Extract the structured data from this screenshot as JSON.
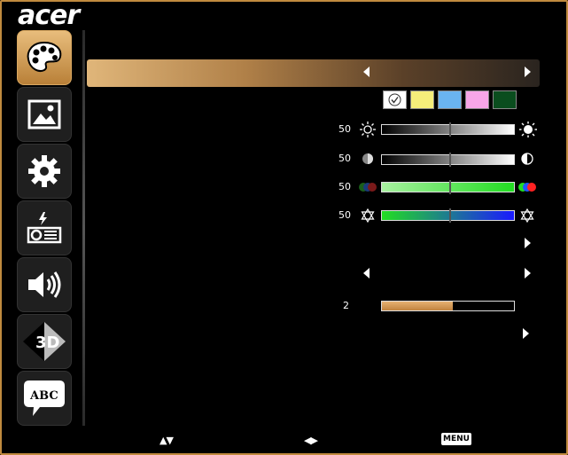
{
  "brand": {
    "logo_text": "acer"
  },
  "sidebar": {
    "items": [
      {
        "name": "color",
        "icon": "palette-icon",
        "active": true
      },
      {
        "name": "picture",
        "icon": "image-icon",
        "active": false
      },
      {
        "name": "settings",
        "icon": "gear-icon",
        "active": false
      },
      {
        "name": "input",
        "icon": "projector-icon",
        "active": false
      },
      {
        "name": "audio",
        "icon": "speaker-icon",
        "active": false
      },
      {
        "name": "3d",
        "icon": "3d-icon",
        "label": "3D",
        "active": false
      },
      {
        "name": "language",
        "icon": "speech-bubble-icon",
        "label": "ABC",
        "active": false
      }
    ]
  },
  "color_swatches": [
    {
      "name": "white",
      "color": "#ffffff",
      "selected": true
    },
    {
      "name": "yellow",
      "color": "#f5ee7a"
    },
    {
      "name": "blue",
      "color": "#6ab4f0"
    },
    {
      "name": "pink",
      "color": "#f7a6e8"
    },
    {
      "name": "dark-green",
      "color": "#0a4d1e"
    }
  ],
  "sliders": [
    {
      "name": "brightness",
      "value": "50",
      "left_icon": "sun-outline-icon",
      "right_icon": "sun-filled-icon"
    },
    {
      "name": "contrast",
      "value": "50",
      "left_icon": "moon-half-icon",
      "right_icon": "contrast-circle-icon"
    },
    {
      "name": "color-saturation",
      "value": "50",
      "left_icon": "rgb-dots-dim-icon",
      "right_icon": "rgb-dots-bright-icon"
    },
    {
      "name": "tint",
      "value": "50",
      "left_icon": "star-of-david-icon",
      "right_icon": "star-of-david-icon"
    }
  ],
  "level": {
    "value": "2",
    "fill_fraction": 0.54
  },
  "footer": {
    "nav_updown": "▲▼",
    "nav_leftright": "◀▶",
    "menu_label": "MENU"
  }
}
